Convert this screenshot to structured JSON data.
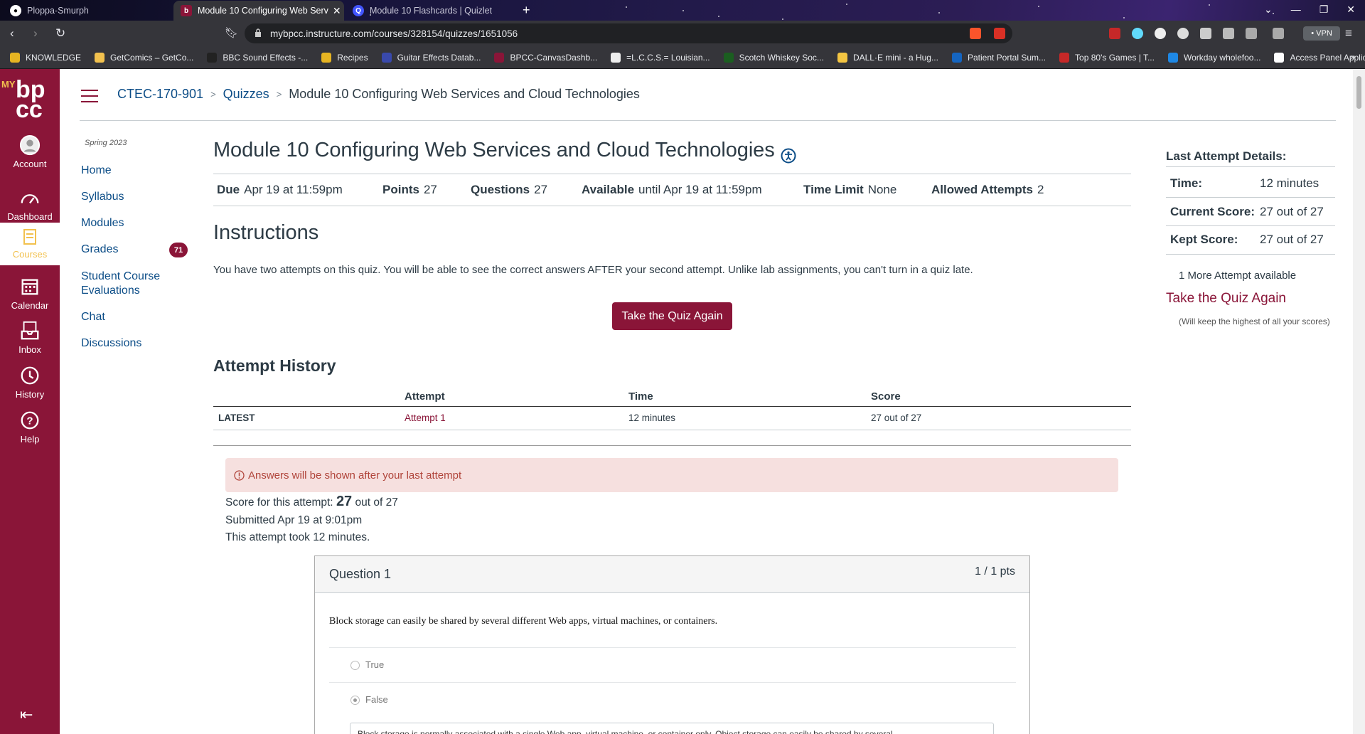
{
  "browser": {
    "tabs": [
      {
        "title": "Ploppa-Smurph",
        "active": false
      },
      {
        "title": "Module 10 Configuring Web Serv",
        "active": true
      },
      {
        "title": "Module 10 Flashcards | Quizlet",
        "active": false
      }
    ],
    "url": "mybpcc.instructure.com/courses/328154/quizzes/1651056",
    "vpn_label": "• VPN",
    "bookmarks": [
      "KNOWLEDGE",
      "GetComics – GetCo...",
      "BBC Sound Effects -...",
      "Recipes",
      "Guitar Effects Datab...",
      "BPCC-CanvasDashb...",
      "=L.C.C.S.= Louisian...",
      "Scotch Whiskey Soc...",
      "DALL·E mini - a Hug...",
      "Patient Portal Sum...",
      "Top 80's Games | T...",
      "Workday wholefoo...",
      "Access Panel Applic..."
    ],
    "bookmarks_more": "»"
  },
  "global_nav": {
    "logo_text": "MY bpcc",
    "items": [
      {
        "label": "Account",
        "icon": "account-icon"
      },
      {
        "label": "Dashboard",
        "icon": "dashboard-icon"
      },
      {
        "label": "Courses",
        "icon": "courses-icon",
        "active": true
      },
      {
        "label": "Calendar",
        "icon": "calendar-icon"
      },
      {
        "label": "Inbox",
        "icon": "inbox-icon"
      },
      {
        "label": "History",
        "icon": "history-icon"
      },
      {
        "label": "Help",
        "icon": "help-icon"
      }
    ],
    "brand_color": "#8a1538"
  },
  "breadcrumb": {
    "course": "CTEC-170-901",
    "section": "Quizzes",
    "current": "Module 10 Configuring Web Services and Cloud Technologies"
  },
  "course_nav": {
    "term": "Spring 2023",
    "items": [
      {
        "label": "Home"
      },
      {
        "label": "Syllabus"
      },
      {
        "label": "Modules"
      },
      {
        "label": "Grades",
        "badge": "71"
      },
      {
        "label": "Student Course Evaluations"
      },
      {
        "label": "Chat"
      },
      {
        "label": "Discussions"
      }
    ]
  },
  "quiz": {
    "title": "Module 10 Configuring Web Services and Cloud Technologies",
    "meta": {
      "due_label": "Due",
      "due_value": "Apr 19 at 11:59pm",
      "points_label": "Points",
      "points_value": "27",
      "questions_label": "Questions",
      "questions_value": "27",
      "available_label": "Available",
      "available_value": "until Apr 19 at 11:59pm",
      "time_limit_label": "Time Limit",
      "time_limit_value": "None",
      "attempts_label": "Allowed Attempts",
      "attempts_value": "2"
    },
    "instructions_heading": "Instructions",
    "instructions_text": "You have two attempts on this quiz. You will be able to see the correct answers AFTER your second attempt. Unlike lab assignments, you can't turn in a quiz late.",
    "take_again_button": "Take the Quiz Again"
  },
  "attempt_history": {
    "heading": "Attempt History",
    "columns": [
      "Attempt",
      "Time",
      "Score"
    ],
    "rows": [
      {
        "tag": "LATEST",
        "attempt": "Attempt 1",
        "time": "12 minutes",
        "score": "27 out of 27"
      }
    ]
  },
  "result": {
    "alert": "Answers will be shown after your last attempt",
    "score_prefix": "Score for this attempt:",
    "score_value": "27",
    "score_suffix": "out of 27",
    "submitted": "Submitted Apr 19 at 9:01pm",
    "duration": "This attempt took 12 minutes."
  },
  "question": {
    "title": "Question 1",
    "points": "1 / 1 pts",
    "text": "Block storage can easily be shared by several different Web apps, virtual machines, or containers.",
    "options": [
      {
        "label": "True",
        "selected": false
      },
      {
        "label": "False",
        "selected": true
      }
    ],
    "feedback": "Block storage is normally associated with a single Web app, virtual machine, or container only. Object storage can easily be shared by several"
  },
  "sidebar": {
    "title": "Last Attempt Details:",
    "time_label": "Time:",
    "time_value": "12 minutes",
    "current_label": "Current Score:",
    "current_value": "27 out of 27",
    "kept_label": "Kept Score:",
    "kept_value": "27 out of 27",
    "more_attempts": "1 More Attempt available",
    "take_again_link": "Take the Quiz Again",
    "note": "(Will keep the highest of all your scores)"
  }
}
